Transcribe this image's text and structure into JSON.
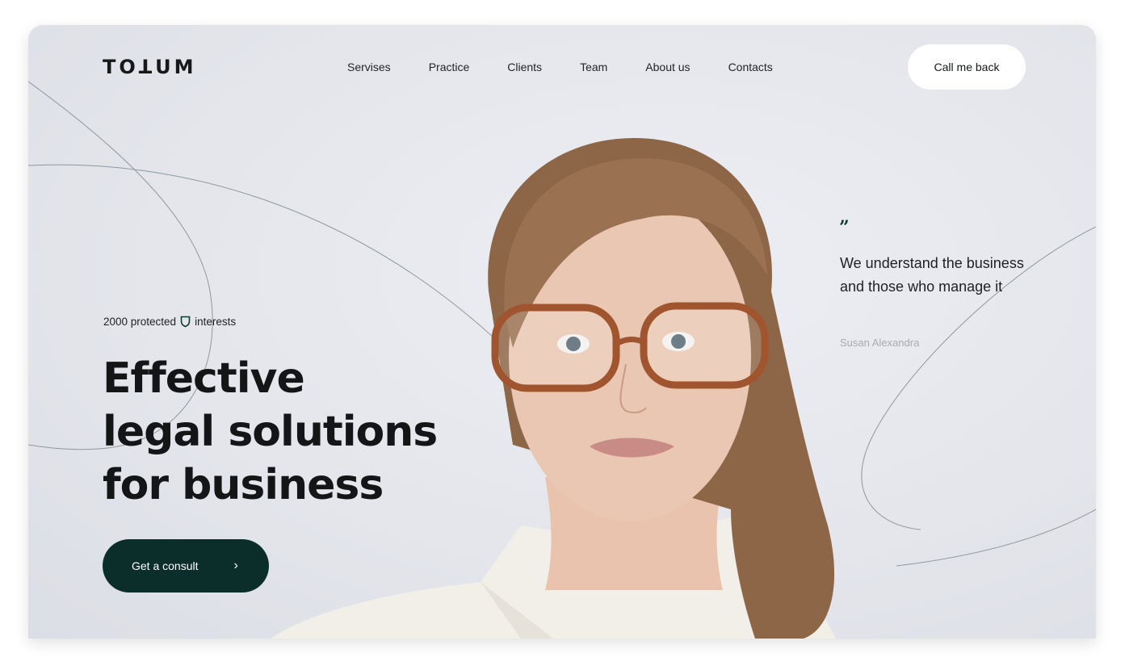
{
  "brand": {
    "logo_text": "TOꓕUM"
  },
  "nav": {
    "items": [
      {
        "label": "Servises"
      },
      {
        "label": "Practice"
      },
      {
        "label": "Clients"
      },
      {
        "label": "Team"
      },
      {
        "label": "About us"
      },
      {
        "label": "Contacts"
      }
    ]
  },
  "header": {
    "cta_label": "Call me back"
  },
  "hero": {
    "stat_prefix": "2000 protected",
    "stat_icon": "shield-icon",
    "stat_suffix": "interests",
    "headline": [
      "Effective",
      "legal solutions",
      "for business"
    ],
    "cta_label": "Get a consult",
    "cta_icon": "chevron-right-icon"
  },
  "quote": {
    "mark": "”",
    "text": "We understand the business and those who manage it",
    "author": "Susan Alexandra"
  },
  "colors": {
    "background": "#e4e6ec",
    "accent": "#0b2e2b",
    "text": "#131517",
    "muted": "#a7aab2"
  }
}
